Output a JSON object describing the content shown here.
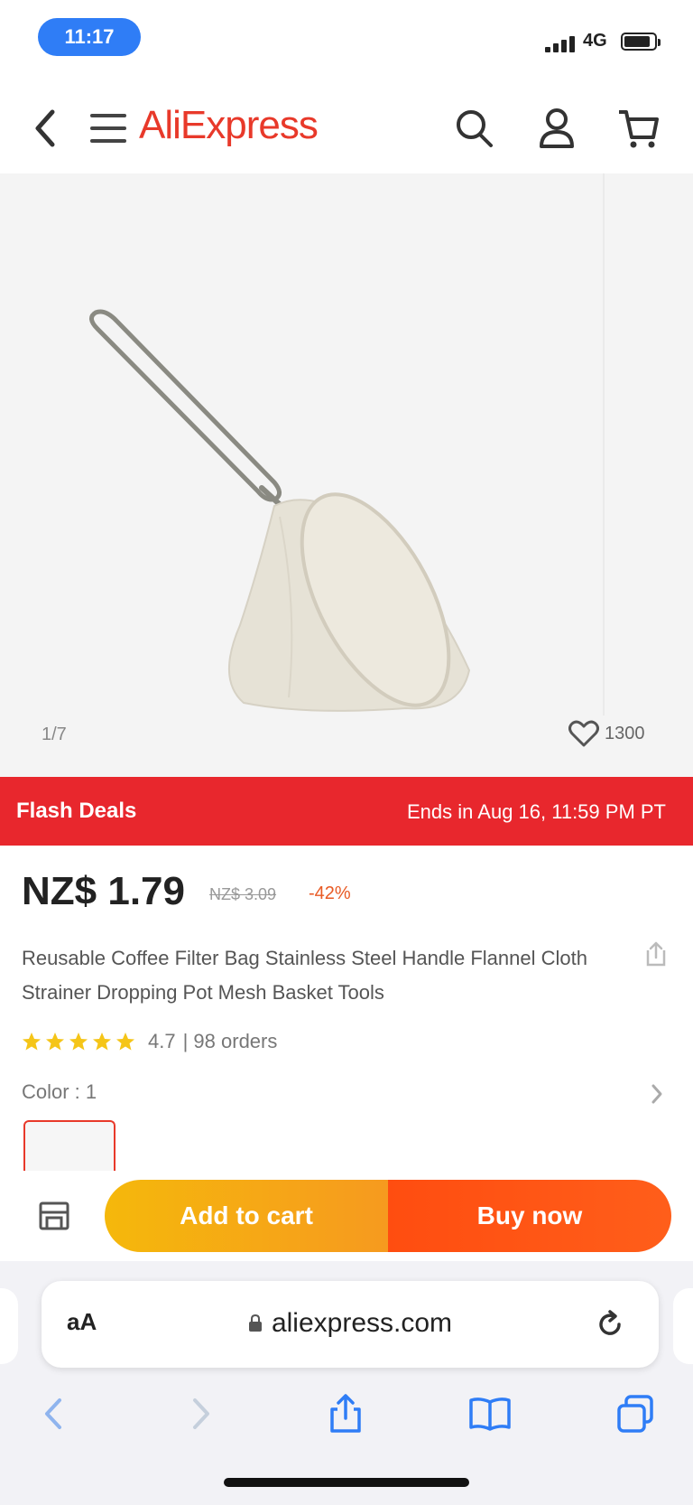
{
  "status_bar": {
    "time": "11:17",
    "network": "4G"
  },
  "header": {
    "logo": "AliExpress"
  },
  "gallery": {
    "counter": "1/7",
    "wishlist_count": "1300"
  },
  "flash_deal": {
    "label": "Flash Deals",
    "ends": "Ends in Aug 16, 11:59 PM PT"
  },
  "product": {
    "price": "NZ$ 1.79",
    "original_price": "NZ$ 3.09",
    "discount": "-42%",
    "title": "Reusable Coffee Filter Bag Stainless Steel Handle Flannel Cloth Strainer Dropping Pot Mesh Basket Tools",
    "rating": "4.7",
    "orders": "| 98 orders",
    "stars": 5,
    "color_label": "Color : 1"
  },
  "actions": {
    "add_to_cart": "Add to cart",
    "buy_now": "Buy now"
  },
  "browser": {
    "aa": "aA",
    "url": "aliexpress.com"
  },
  "colors": {
    "brand": "#e8392a",
    "flash": "#e8272d",
    "cart": "#f5b80b",
    "buy": "#ff4d10",
    "safari_blue": "#2f7df6"
  }
}
